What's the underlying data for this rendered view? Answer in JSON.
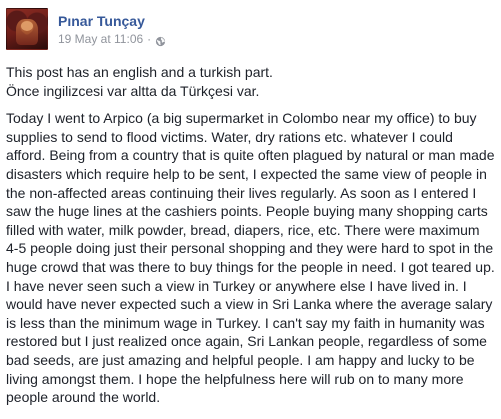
{
  "post": {
    "author": "Pınar Tunçay",
    "timestamp": "19 May at 11:06",
    "separator": "·",
    "privacy_icon": "globe-icon",
    "intro": [
      "This post has an english and a turkish part.",
      "Önce ingilizcesi var altta da Türkçesi var."
    ],
    "body": "Today I went to Arpico (a big supermarket in Colombo near my office) to buy supplies to send to flood victims. Water, dry rations etc. whatever I could afford. Being from a country that is quite often plagued by natural or man made disasters which require help to be sent, I expected the same view of people in the non-affected areas continuing their lives regularly. As soon as I entered I saw the huge lines at the cashiers points. People buying many shopping carts filled with water, milk powder, bread, diapers, rice, etc. There were maximum 4-5 people doing just their personal shopping and they were hard to spot in the huge crowd that was there to buy things for the people in need. I got teared up. I have never seen such a view in Turkey or anywhere else I have lived in. I would have never expected such a view in Sri Lanka where the average salary is less than the minimum wage in Turkey. I can't say my faith in humanity was restored but I just realized once again, Sri Lankan people, regardless of some bad seeds, are just amazing and helpful people. I am happy and lucky to be living amongst them. I hope the helpfulness here will rub on to many more people around the world."
  },
  "colors": {
    "author": "#365899",
    "meta": "#90949c",
    "text": "#1d2129",
    "background": "#ffffff"
  }
}
